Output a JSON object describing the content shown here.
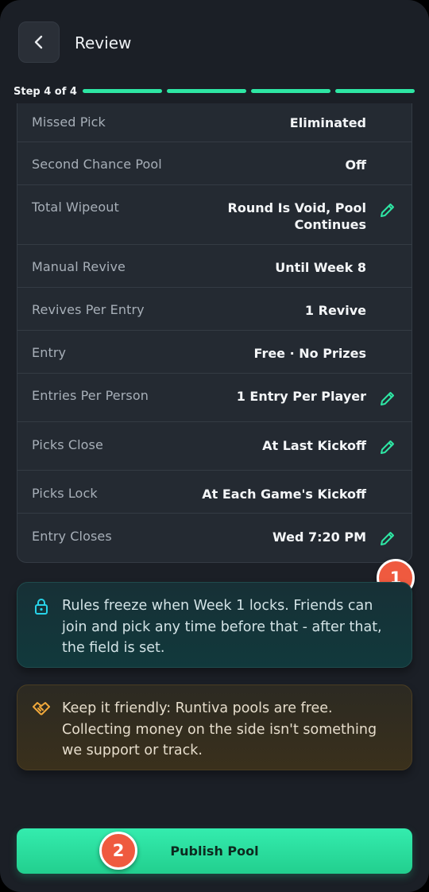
{
  "header": {
    "title": "Review",
    "back_icon": "chevron-left-icon"
  },
  "progress": {
    "label": "Step 4 of 4",
    "current_step": 4,
    "total_steps": 4,
    "accent_color": "#2ee6a4"
  },
  "settings": [
    {
      "label": "Missed Pick",
      "value": "Eliminated",
      "editable": false
    },
    {
      "label": "Second Chance Pool",
      "value": "Off",
      "editable": false
    },
    {
      "label": "Total Wipeout",
      "value_line1": "Round Is Void, Pool",
      "value_line2": "Continues",
      "editable": true
    },
    {
      "label": "Manual Revive",
      "value": "Until Week 8",
      "editable": false
    },
    {
      "label": "Revives Per Entry",
      "value": "1 Revive",
      "editable": false
    },
    {
      "label": "Entry",
      "value": "Free · No Prizes",
      "editable": false
    },
    {
      "label": "Entries Per Person",
      "value": "1 Entry Per Player",
      "editable": true
    },
    {
      "label": "Picks Close",
      "value": "At Last Kickoff",
      "editable": true
    },
    {
      "label": "Picks Lock",
      "value": "At Each Game's Kickoff",
      "editable": false
    },
    {
      "label": "Entry Closes",
      "value": "Wed 7:20 PM",
      "editable": true
    }
  ],
  "badges": {
    "first": "1",
    "second": "2",
    "color": "#ef5a3f"
  },
  "notices": {
    "info": {
      "icon": "lock-icon",
      "text": "Rules freeze when Week 1 locks. Friends can join and pick any time before that - after that, the field is set."
    },
    "warning": {
      "icon": "handshake-icon",
      "text": "Keep it friendly: Runtiva pools are free. Collecting money on the side isn't something we support or track."
    }
  },
  "actions": {
    "publish_label": "Publish Pool"
  }
}
